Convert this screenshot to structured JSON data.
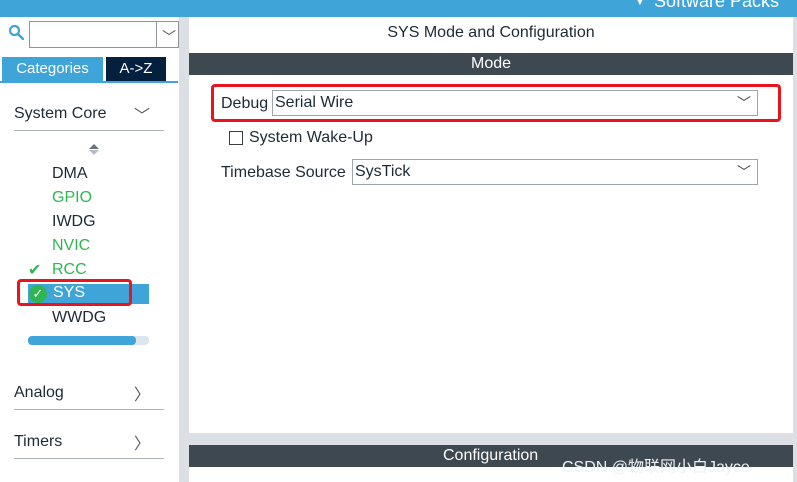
{
  "topbar": {
    "software_packs": "Software Packs",
    "arrow": "▼"
  },
  "sidebar": {
    "search": {
      "value": "",
      "placeholder": ""
    },
    "tabs": {
      "categories": "Categories",
      "az": "A->Z"
    },
    "sections": {
      "system_core": "System Core",
      "analog": "Analog",
      "timers": "Timers"
    },
    "items": [
      "DMA",
      "GPIO",
      "IWDG",
      "NVIC",
      "RCC",
      "SYS",
      "WWDG"
    ],
    "selected": "SYS"
  },
  "main": {
    "title": "SYS Mode and Configuration",
    "mode_header": "Mode",
    "debug": {
      "label": "Debug",
      "value": "Serial Wire"
    },
    "wakeup": {
      "label": "System Wake-Up",
      "checked": false
    },
    "timebase": {
      "label": "Timebase Source",
      "value": "SysTick"
    },
    "config_header": "Configuration"
  },
  "watermark": "CSDN @物联网小白Jayce",
  "colors": {
    "accent": "#3fa5d8",
    "dark_header": "#3e4851",
    "az_tab": "#03213f",
    "ok_green": "#2fb653",
    "highlight_red": "#e8141e"
  }
}
